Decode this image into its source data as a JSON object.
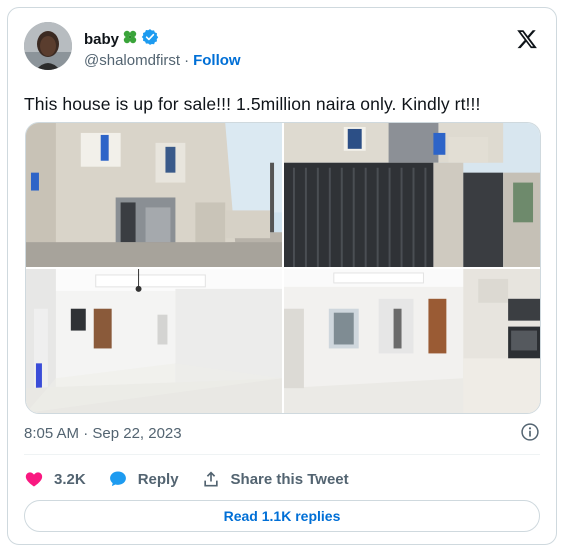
{
  "author": {
    "display_name": "baby",
    "name_emoji": "four-leaf-clover",
    "verified": true,
    "handle": "@shalomdfirst",
    "separator": "·",
    "follow_label": "Follow"
  },
  "tweet": {
    "text": "This house is up for sale!!! 1.5million naira only. Kindly rt!!!"
  },
  "media": {
    "count": 4,
    "photos": [
      "exterior-front-photo",
      "exterior-gate-photo",
      "interior-living-room-photo",
      "interior-kitchen-photo"
    ]
  },
  "meta": {
    "timestamp": "8:05 AM · Sep 22, 2023"
  },
  "actions": {
    "likes_count": "3.2K",
    "reply_label": "Reply",
    "share_label": "Share this Tweet"
  },
  "footer": {
    "read_replies_label": "Read 1.1K replies"
  },
  "colors": {
    "brand_blue": "#1d9bf0",
    "link_blue": "#006fd6",
    "like_red": "#f91880",
    "text_primary": "#0f1419",
    "text_secondary": "#536471",
    "border": "#cfd9de"
  }
}
